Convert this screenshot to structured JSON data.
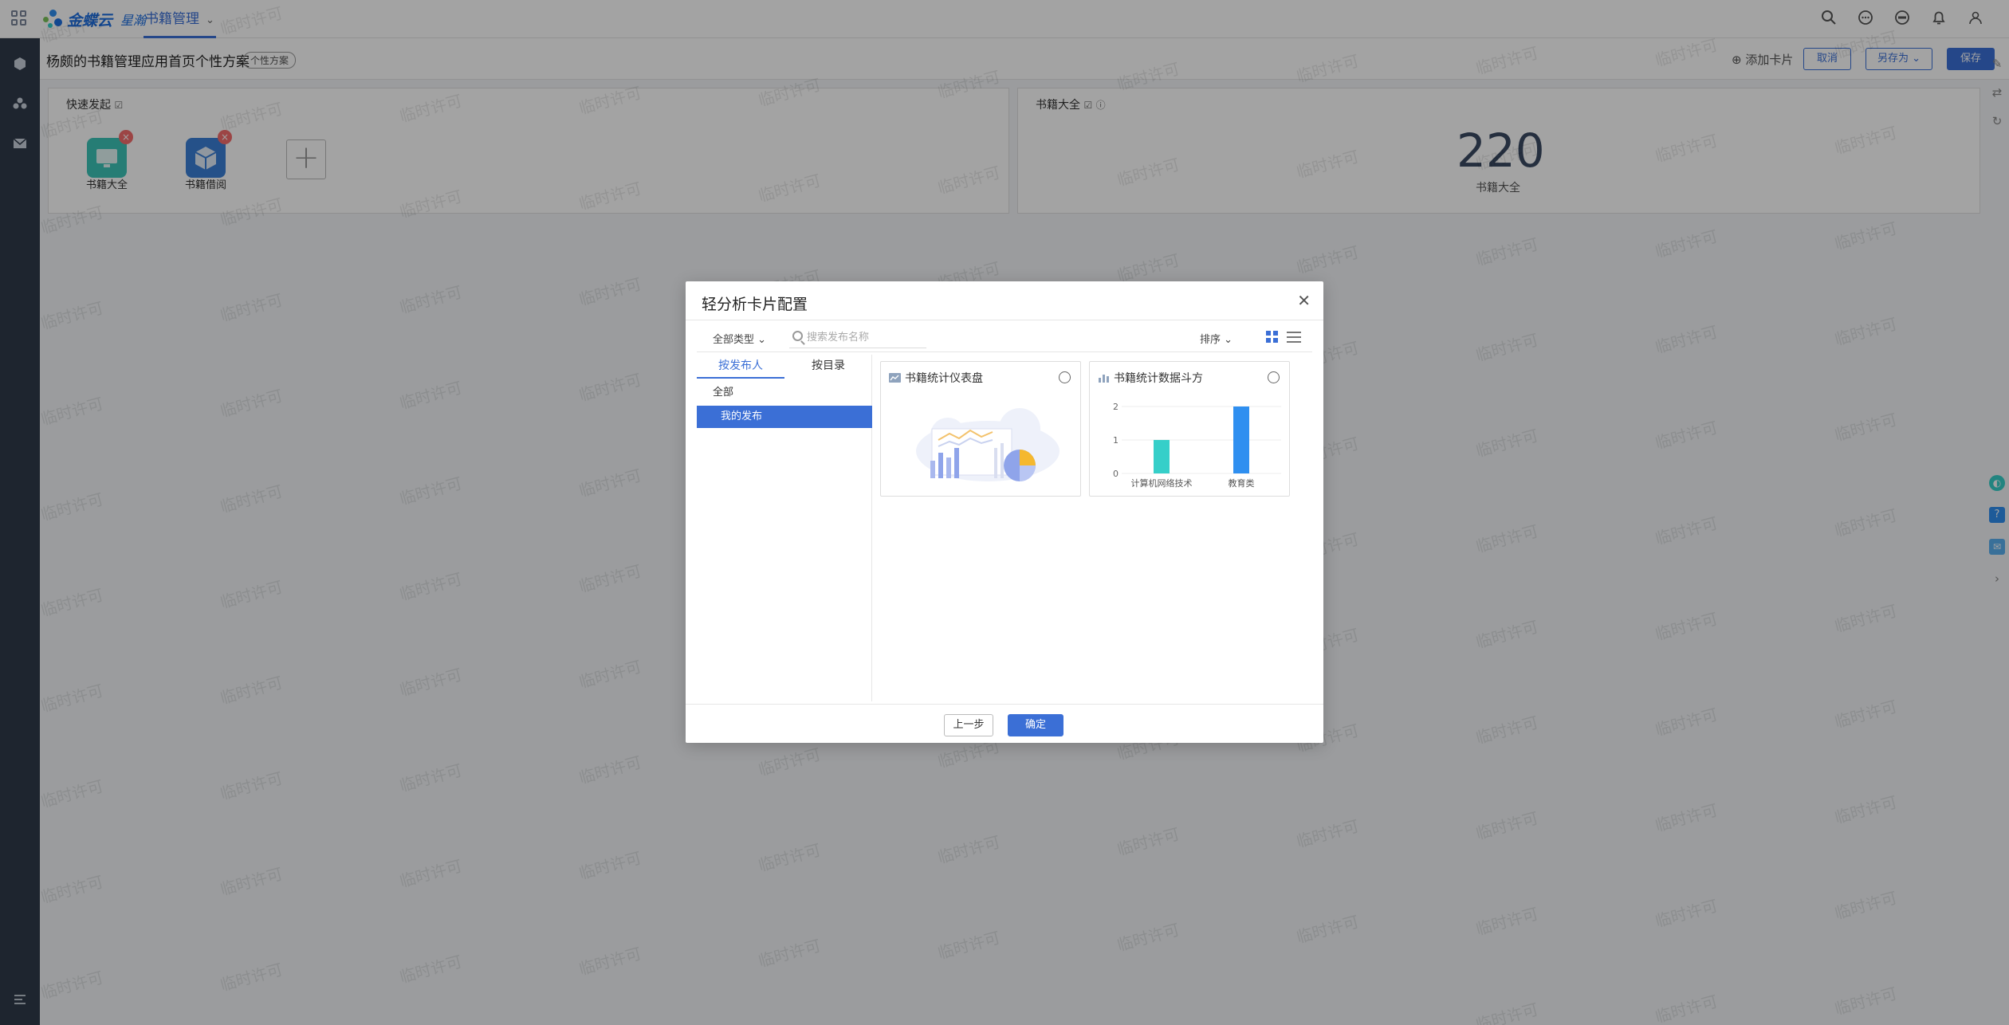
{
  "topbar": {
    "logo_text": "金蝶云",
    "logo_sub": "星瀚",
    "app_tab": "书籍管理"
  },
  "subheader": {
    "page_title": "杨颇的书籍管理应用首页个性方案",
    "tag": "个性方案",
    "add_card": "添加卡片",
    "cancel": "取消",
    "save_as": "另存为",
    "save": "保存"
  },
  "cards": {
    "quick_launch": {
      "title": "快速发起",
      "items": [
        {
          "label": "书籍大全"
        },
        {
          "label": "书籍借阅"
        }
      ]
    },
    "books_total": {
      "title": "书籍大全",
      "value": "220",
      "label": "书籍大全"
    }
  },
  "watermark": "临时许可",
  "modal": {
    "title": "轻分析卡片配置",
    "filter_type": "全部类型",
    "search_placeholder": "搜索发布名称",
    "sort": "排序",
    "tabs": [
      {
        "label": "按发布人"
      },
      {
        "label": "按目录"
      }
    ],
    "tree": [
      {
        "label": "全部"
      },
      {
        "label": "我的发布"
      }
    ],
    "results": [
      {
        "title": "书籍统计仪表盘"
      },
      {
        "title": "书籍统计数据斗方"
      }
    ],
    "prev_button": "上一步",
    "ok_button": "确定"
  },
  "chart_data": {
    "type": "bar",
    "categories": [
      "计算机网络技术",
      "教育类"
    ],
    "values": [
      1,
      2
    ],
    "ylim": [
      0,
      2
    ],
    "yticks": [
      "0",
      "1",
      "2"
    ],
    "colors": [
      "#36cfc9",
      "#2f8ff0"
    ]
  }
}
